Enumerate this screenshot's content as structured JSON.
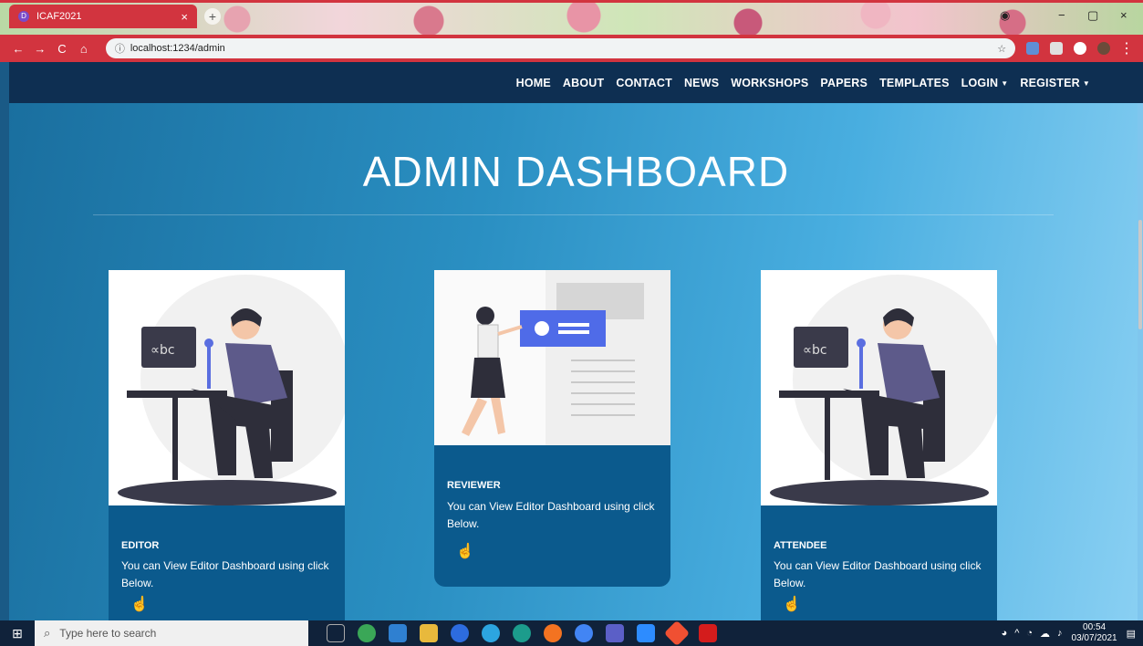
{
  "browser": {
    "tab_title": "ICAF2021",
    "close_tab": "×",
    "new_tab": "+",
    "url": "localhost:1234/admin",
    "back": "←",
    "forward": "→",
    "reload": "C",
    "home": "⌂",
    "window_min": "−",
    "window_max": "▢",
    "window_close": "×"
  },
  "nav": {
    "items": [
      "HOME",
      "ABOUT",
      "CONTACT",
      "NEWS",
      "WORKSHOPS",
      "PAPERS",
      "TEMPLATES",
      "LOGIN",
      "REGISTER"
    ]
  },
  "page": {
    "title": "ADMIN DASHBOARD"
  },
  "cards": [
    {
      "name": "EDITOR",
      "description": "You can View Editor Dashboard using click Below."
    },
    {
      "name": "REVIEWER",
      "description": "You can View Editor Dashboard using click Below."
    },
    {
      "name": "ATTENDEE",
      "description": "You can View Editor Dashboard using click Below."
    }
  ],
  "taskbar": {
    "search_placeholder": "Type here to search",
    "time": "00:54",
    "date": "03/07/2021"
  },
  "colors": {
    "browser_accent": "#d2343f",
    "nav_bg": "#0e2f52",
    "card_bg": "#0b5a8d"
  }
}
